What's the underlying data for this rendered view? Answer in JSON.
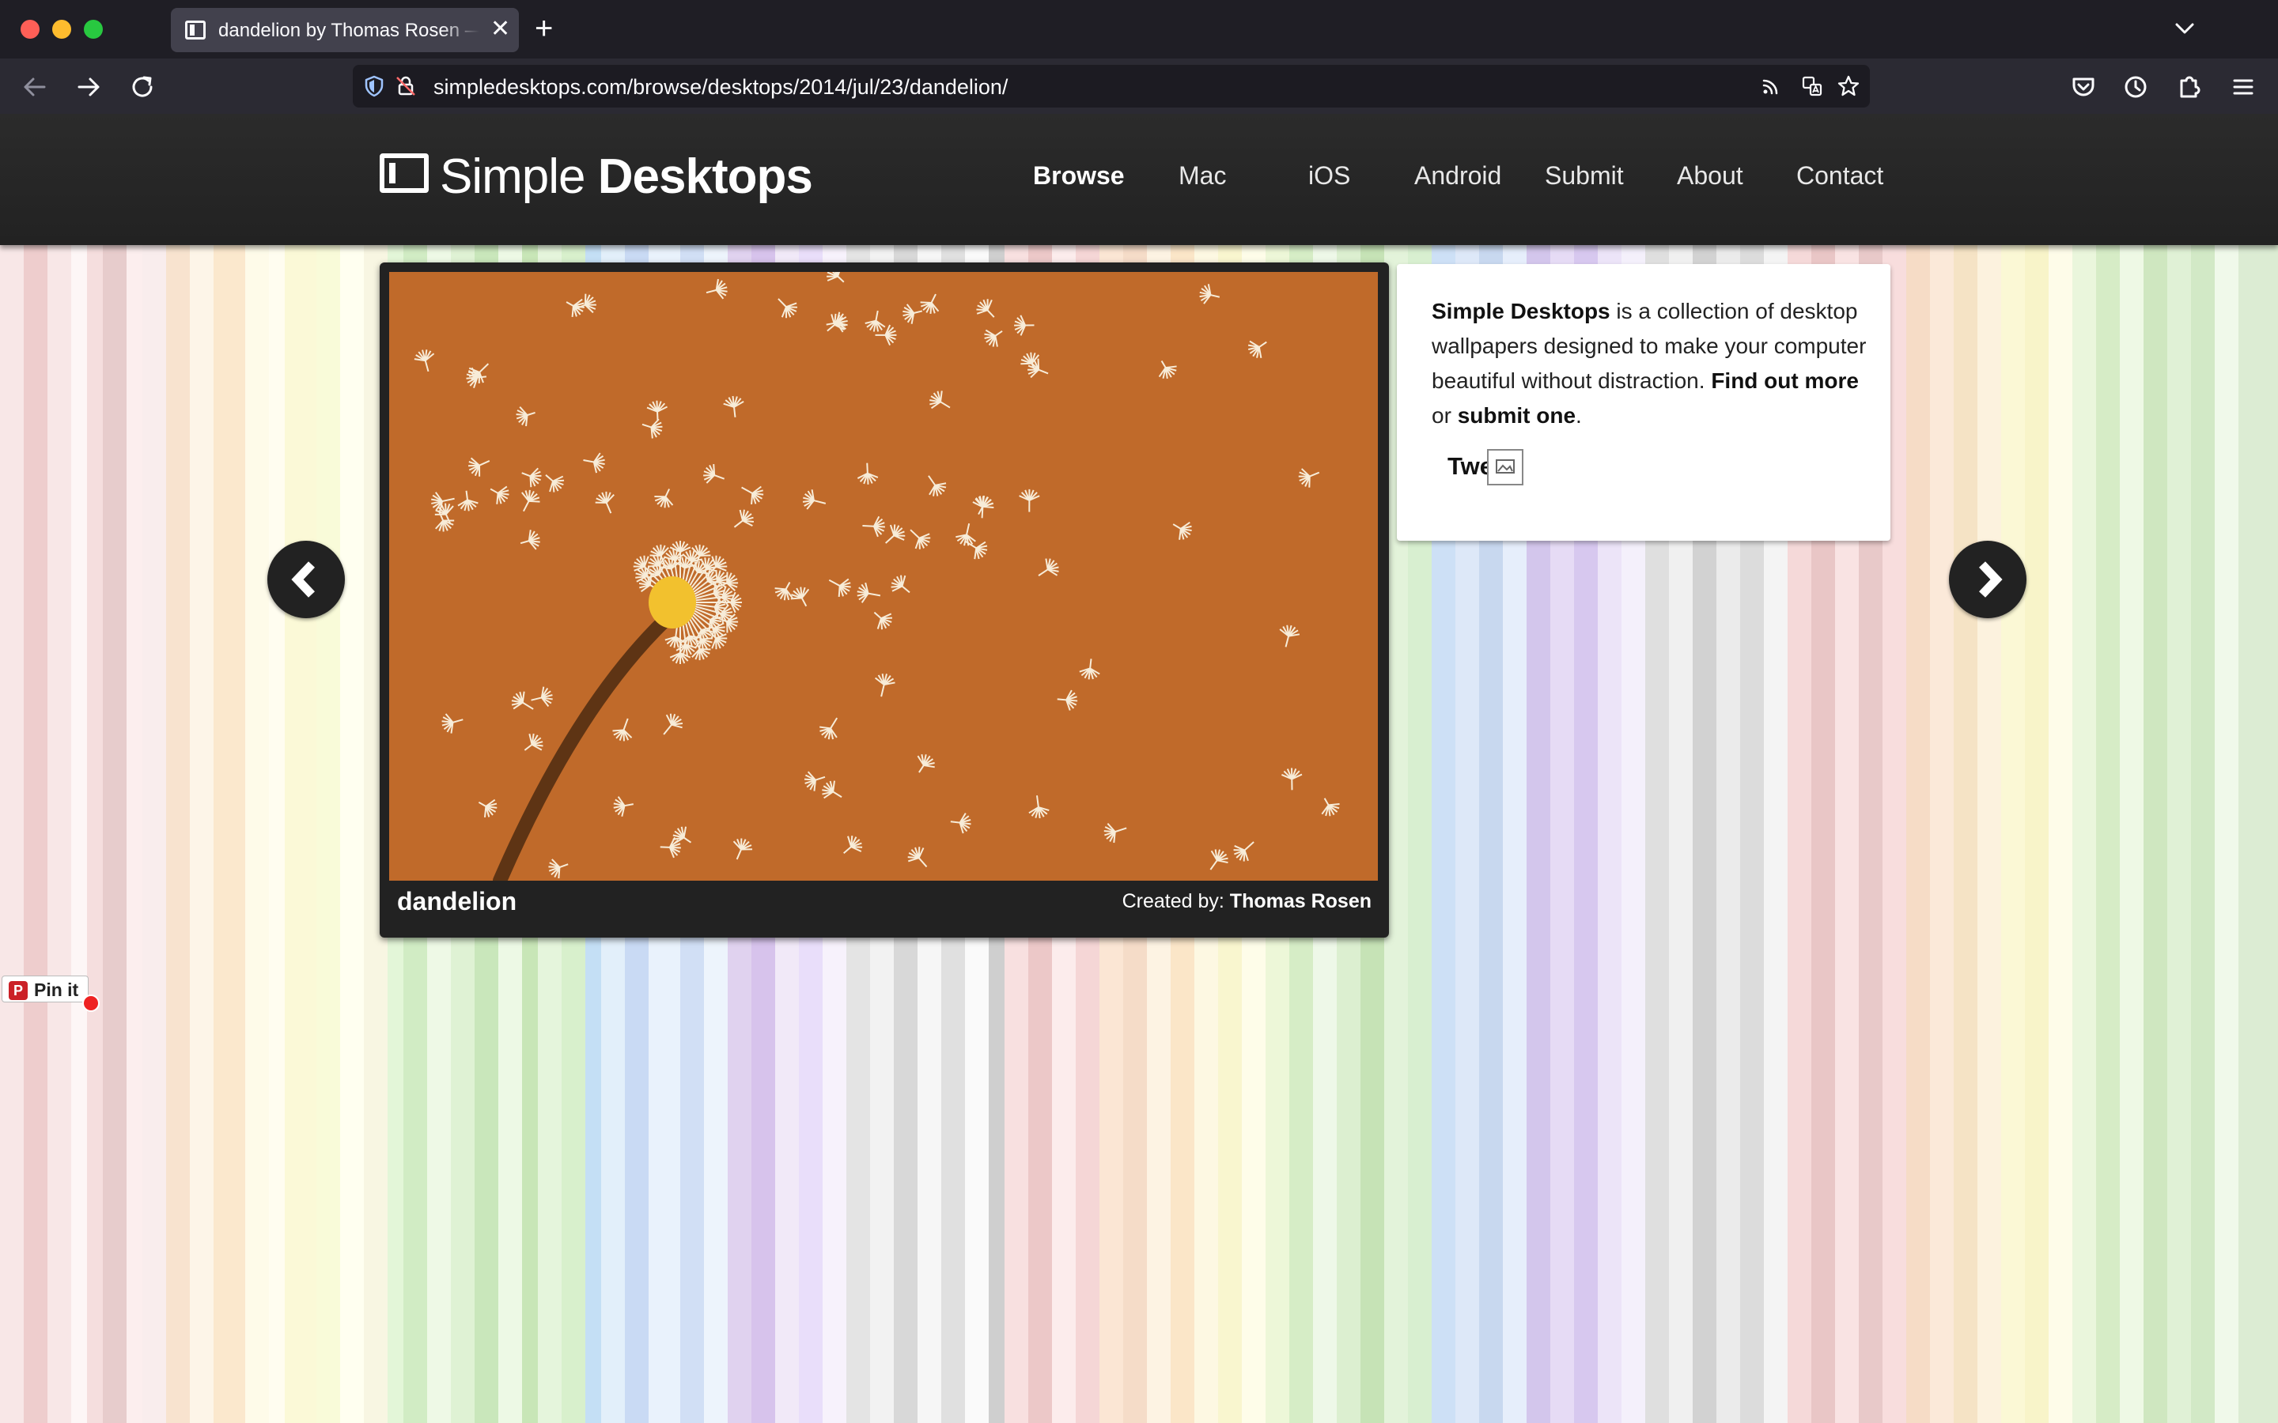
{
  "browser": {
    "tab_title": "dandelion by Thomas Rosen — Simple Desktops",
    "tab_close": "✕",
    "new_tab": "+",
    "url": "simpledesktops.com/browse/desktops/2014/jul/23/dandelion/"
  },
  "site": {
    "logo_light": "Simple",
    "logo_bold": "Desktops",
    "nav": {
      "browse": "Browse",
      "mac": "Mac",
      "ios": "iOS",
      "android": "Android",
      "submit": "Submit",
      "about": "About",
      "contact": "Contact"
    }
  },
  "wallpaper": {
    "title": "dandelion",
    "credit_label": "Created by:",
    "author": "Thomas Rosen",
    "colors": {
      "background": "#c06a2a",
      "seeds": "#f7ecd8",
      "center": "#f2c12e",
      "stem": "#5e3414"
    }
  },
  "about": {
    "site_name": "Simple Desktops",
    "description": "is a collection of desktop wallpapers designed to make your computer beautiful without distraction.",
    "find_out_more": "Find out more",
    "or": "or",
    "submit_one": "submit one",
    "period": ".",
    "tweet": "Twe"
  },
  "pinterest": {
    "label": "Pin it",
    "logo": "P"
  }
}
